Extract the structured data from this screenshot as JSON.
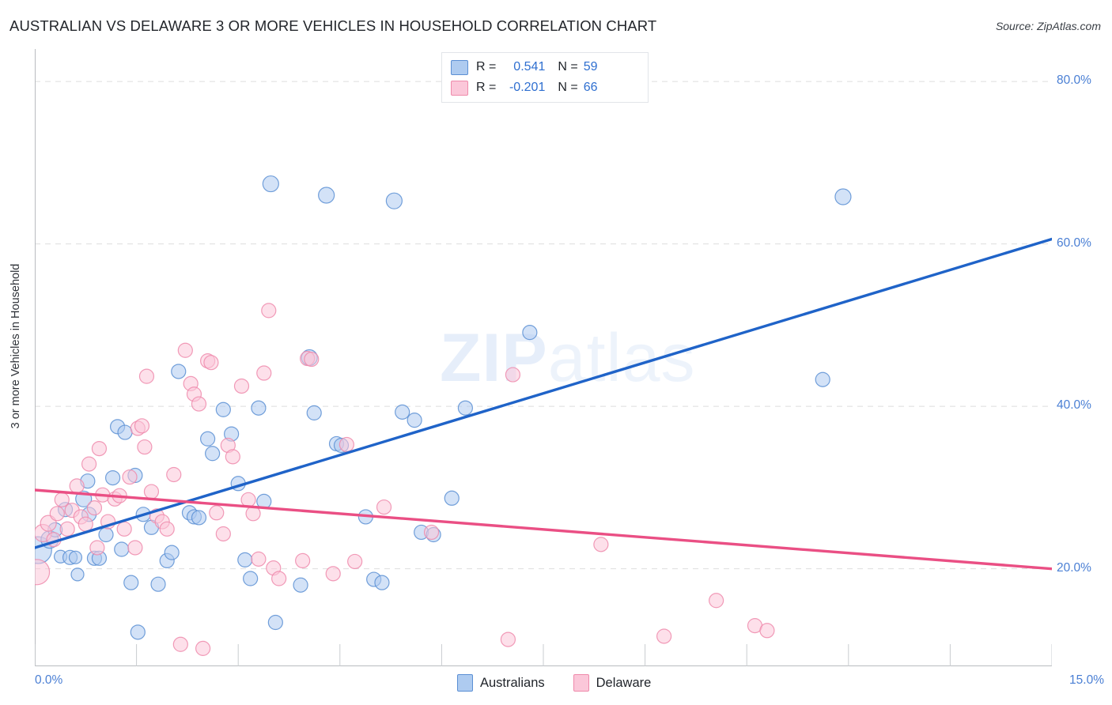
{
  "header": {
    "title": "AUSTRALIAN VS DELAWARE 3 OR MORE VEHICLES IN HOUSEHOLD CORRELATION CHART",
    "source": "Source: ZipAtlas.com"
  },
  "watermark": {
    "strong": "ZIP",
    "light": "atlas"
  },
  "legend": {
    "series1": {
      "r_label": "R =",
      "r_value": "0.541",
      "n_label": "N =",
      "n_value": "59"
    },
    "series2": {
      "r_label": "R =",
      "r_value": "-0.201",
      "n_label": "N =",
      "n_value": "66"
    }
  },
  "bottom_legend": {
    "item1": "Australians",
    "item2": "Delaware"
  },
  "axes": {
    "ylabel": "3 or more Vehicles in Household",
    "yticks": [
      "80.0%",
      "60.0%",
      "40.0%",
      "20.0%"
    ],
    "xticks": [
      "0.0%",
      "15.0%"
    ]
  },
  "colors": {
    "blue_fill": "#aecbf0",
    "blue_stroke": "#5b8fd4",
    "pink_fill": "#fbc7d9",
    "pink_stroke": "#ef8aab",
    "blue_line": "#1f63c8",
    "pink_line": "#ea4f84",
    "tick_text": "#4a7fd4",
    "grid": "#dddddd"
  },
  "chart_data": {
    "type": "scatter",
    "title": "AUSTRALIAN VS DELAWARE 3 OR MORE VEHICLES IN HOUSEHOLD CORRELATION CHART",
    "xlabel": "",
    "ylabel": "3 or more Vehicles in Household",
    "xlim": [
      0.0,
      15.0
    ],
    "ylim": [
      8.0,
      84.0
    ],
    "xtick_values": [
      0.0,
      15.0
    ],
    "ytick_values": [
      20.0,
      40.0,
      60.0,
      80.0
    ],
    "grid": "horizontal-dashed",
    "legend_position": "top-center",
    "series": [
      {
        "name": "Australians",
        "color": "#aecbf0",
        "R": 0.541,
        "N": 59,
        "trendline": {
          "x0": 0.0,
          "y0": 22.6,
          "x1": 15.0,
          "y1": 60.6
        },
        "points": [
          {
            "x": 0.05,
            "y": 22.3,
            "r": 17
          },
          {
            "x": 0.22,
            "y": 23.6,
            "r": 11
          },
          {
            "x": 0.3,
            "y": 24.8,
            "r": 9
          },
          {
            "x": 0.38,
            "y": 21.5,
            "r": 8
          },
          {
            "x": 0.45,
            "y": 27.3,
            "r": 9
          },
          {
            "x": 0.52,
            "y": 21.4,
            "r": 9
          },
          {
            "x": 0.6,
            "y": 21.4,
            "r": 8
          },
          {
            "x": 0.63,
            "y": 19.3,
            "r": 8
          },
          {
            "x": 0.72,
            "y": 28.6,
            "r": 10
          },
          {
            "x": 0.78,
            "y": 30.8,
            "r": 9
          },
          {
            "x": 0.8,
            "y": 26.7,
            "r": 9
          },
          {
            "x": 0.88,
            "y": 21.3,
            "r": 9
          },
          {
            "x": 0.95,
            "y": 21.3,
            "r": 9
          },
          {
            "x": 1.05,
            "y": 24.2,
            "r": 9
          },
          {
            "x": 1.15,
            "y": 31.2,
            "r": 9
          },
          {
            "x": 1.22,
            "y": 37.5,
            "r": 9
          },
          {
            "x": 1.28,
            "y": 22.4,
            "r": 9
          },
          {
            "x": 1.33,
            "y": 36.8,
            "r": 9
          },
          {
            "x": 1.42,
            "y": 18.3,
            "r": 9
          },
          {
            "x": 1.48,
            "y": 31.5,
            "r": 9
          },
          {
            "x": 1.52,
            "y": 12.2,
            "r": 9
          },
          {
            "x": 1.6,
            "y": 26.7,
            "r": 9
          },
          {
            "x": 1.72,
            "y": 25.1,
            "r": 9
          },
          {
            "x": 1.82,
            "y": 18.1,
            "r": 9
          },
          {
            "x": 1.95,
            "y": 21.0,
            "r": 9
          },
          {
            "x": 2.02,
            "y": 22.0,
            "r": 9
          },
          {
            "x": 2.12,
            "y": 44.3,
            "r": 9
          },
          {
            "x": 2.28,
            "y": 26.9,
            "r": 9
          },
          {
            "x": 2.35,
            "y": 26.4,
            "r": 9
          },
          {
            "x": 2.42,
            "y": 26.3,
            "r": 9
          },
          {
            "x": 2.55,
            "y": 36.0,
            "r": 9
          },
          {
            "x": 2.62,
            "y": 34.2,
            "r": 9
          },
          {
            "x": 2.78,
            "y": 39.6,
            "r": 9
          },
          {
            "x": 2.9,
            "y": 36.6,
            "r": 9
          },
          {
            "x": 3.0,
            "y": 30.5,
            "r": 9
          },
          {
            "x": 3.1,
            "y": 21.1,
            "r": 9
          },
          {
            "x": 3.18,
            "y": 18.8,
            "r": 9
          },
          {
            "x": 3.3,
            "y": 39.8,
            "r": 9
          },
          {
            "x": 3.38,
            "y": 28.3,
            "r": 9
          },
          {
            "x": 3.48,
            "y": 67.4,
            "r": 10
          },
          {
            "x": 3.55,
            "y": 13.4,
            "r": 9
          },
          {
            "x": 3.92,
            "y": 18.0,
            "r": 9
          },
          {
            "x": 4.05,
            "y": 46.0,
            "r": 10
          },
          {
            "x": 4.12,
            "y": 39.2,
            "r": 9
          },
          {
            "x": 4.3,
            "y": 66.0,
            "r": 10
          },
          {
            "x": 4.45,
            "y": 35.4,
            "r": 9
          },
          {
            "x": 4.52,
            "y": 35.2,
            "r": 9
          },
          {
            "x": 4.88,
            "y": 26.4,
            "r": 9
          },
          {
            "x": 5.0,
            "y": 18.7,
            "r": 9
          },
          {
            "x": 5.12,
            "y": 18.3,
            "r": 9
          },
          {
            "x": 5.3,
            "y": 65.3,
            "r": 10
          },
          {
            "x": 5.42,
            "y": 39.3,
            "r": 9
          },
          {
            "x": 5.6,
            "y": 38.3,
            "r": 9
          },
          {
            "x": 5.7,
            "y": 24.5,
            "r": 9
          },
          {
            "x": 5.88,
            "y": 24.2,
            "r": 9
          },
          {
            "x": 6.15,
            "y": 28.7,
            "r": 9
          },
          {
            "x": 6.35,
            "y": 39.8,
            "r": 9
          },
          {
            "x": 7.3,
            "y": 49.1,
            "r": 9
          },
          {
            "x": 11.62,
            "y": 43.3,
            "r": 9
          },
          {
            "x": 11.92,
            "y": 65.8,
            "r": 10
          }
        ]
      },
      {
        "name": "Delaware",
        "color": "#fbc7d9",
        "R": -0.201,
        "N": 66,
        "trendline": {
          "x0": 0.0,
          "y0": 29.7,
          "x1": 15.0,
          "y1": 20.0
        },
        "points": [
          {
            "x": 0.03,
            "y": 19.6,
            "r": 16
          },
          {
            "x": 0.12,
            "y": 24.4,
            "r": 11
          },
          {
            "x": 0.2,
            "y": 25.6,
            "r": 10
          },
          {
            "x": 0.28,
            "y": 23.6,
            "r": 9
          },
          {
            "x": 0.33,
            "y": 26.8,
            "r": 9
          },
          {
            "x": 0.4,
            "y": 28.5,
            "r": 9
          },
          {
            "x": 0.48,
            "y": 24.9,
            "r": 9
          },
          {
            "x": 0.55,
            "y": 27.2,
            "r": 9
          },
          {
            "x": 0.62,
            "y": 30.2,
            "r": 9
          },
          {
            "x": 0.68,
            "y": 26.4,
            "r": 9
          },
          {
            "x": 0.75,
            "y": 25.5,
            "r": 9
          },
          {
            "x": 0.8,
            "y": 32.9,
            "r": 9
          },
          {
            "x": 0.88,
            "y": 27.5,
            "r": 9
          },
          {
            "x": 0.95,
            "y": 34.8,
            "r": 9
          },
          {
            "x": 1.0,
            "y": 29.1,
            "r": 9
          },
          {
            "x": 1.08,
            "y": 25.8,
            "r": 9
          },
          {
            "x": 1.18,
            "y": 28.6,
            "r": 9
          },
          {
            "x": 1.25,
            "y": 29.0,
            "r": 9
          },
          {
            "x": 1.32,
            "y": 24.9,
            "r": 9
          },
          {
            "x": 1.4,
            "y": 31.3,
            "r": 9
          },
          {
            "x": 1.48,
            "y": 22.6,
            "r": 9
          },
          {
            "x": 1.52,
            "y": 37.3,
            "r": 9
          },
          {
            "x": 1.58,
            "y": 37.6,
            "r": 9
          },
          {
            "x": 1.65,
            "y": 43.7,
            "r": 9
          },
          {
            "x": 1.72,
            "y": 29.5,
            "r": 9
          },
          {
            "x": 1.8,
            "y": 26.5,
            "r": 9
          },
          {
            "x": 1.88,
            "y": 25.8,
            "r": 9
          },
          {
            "x": 1.95,
            "y": 24.9,
            "r": 9
          },
          {
            "x": 2.05,
            "y": 31.6,
            "r": 9
          },
          {
            "x": 2.15,
            "y": 10.7,
            "r": 9
          },
          {
            "x": 2.22,
            "y": 46.9,
            "r": 9
          },
          {
            "x": 2.3,
            "y": 42.8,
            "r": 9
          },
          {
            "x": 2.35,
            "y": 41.5,
            "r": 9
          },
          {
            "x": 2.42,
            "y": 40.3,
            "r": 9
          },
          {
            "x": 2.48,
            "y": 10.2,
            "r": 9
          },
          {
            "x": 2.55,
            "y": 45.6,
            "r": 9
          },
          {
            "x": 2.6,
            "y": 45.4,
            "r": 9
          },
          {
            "x": 2.68,
            "y": 26.9,
            "r": 9
          },
          {
            "x": 2.78,
            "y": 24.3,
            "r": 9
          },
          {
            "x": 2.85,
            "y": 35.2,
            "r": 9
          },
          {
            "x": 2.92,
            "y": 33.8,
            "r": 9
          },
          {
            "x": 3.05,
            "y": 42.5,
            "r": 9
          },
          {
            "x": 3.15,
            "y": 28.5,
            "r": 9
          },
          {
            "x": 3.22,
            "y": 26.8,
            "r": 9
          },
          {
            "x": 3.3,
            "y": 21.2,
            "r": 9
          },
          {
            "x": 3.38,
            "y": 44.1,
            "r": 9
          },
          {
            "x": 3.45,
            "y": 51.8,
            "r": 9
          },
          {
            "x": 3.52,
            "y": 20.1,
            "r": 9
          },
          {
            "x": 3.6,
            "y": 18.8,
            "r": 9
          },
          {
            "x": 3.95,
            "y": 21.0,
            "r": 9
          },
          {
            "x": 4.02,
            "y": 45.9,
            "r": 9
          },
          {
            "x": 4.08,
            "y": 45.8,
            "r": 9
          },
          {
            "x": 4.4,
            "y": 19.4,
            "r": 9
          },
          {
            "x": 4.6,
            "y": 35.3,
            "r": 9
          },
          {
            "x": 4.72,
            "y": 20.9,
            "r": 9
          },
          {
            "x": 5.15,
            "y": 27.6,
            "r": 9
          },
          {
            "x": 5.85,
            "y": 24.5,
            "r": 9
          },
          {
            "x": 6.98,
            "y": 11.3,
            "r": 9
          },
          {
            "x": 7.05,
            "y": 43.9,
            "r": 9
          },
          {
            "x": 8.35,
            "y": 23.0,
            "r": 9
          },
          {
            "x": 9.28,
            "y": 11.7,
            "r": 9
          },
          {
            "x": 10.05,
            "y": 16.1,
            "r": 9
          },
          {
            "x": 10.62,
            "y": 13.0,
            "r": 9
          },
          {
            "x": 10.8,
            "y": 12.4,
            "r": 9
          },
          {
            "x": 1.62,
            "y": 35.0,
            "r": 9
          },
          {
            "x": 0.92,
            "y": 22.6,
            "r": 9
          }
        ]
      }
    ]
  }
}
